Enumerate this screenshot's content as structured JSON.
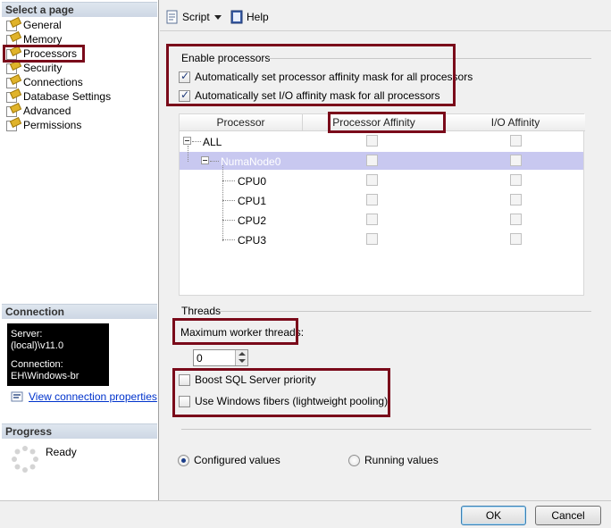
{
  "left_pane": {
    "select_page_header": "Select a page",
    "pages": [
      {
        "label": "General"
      },
      {
        "label": "Memory"
      },
      {
        "label": "Processors"
      },
      {
        "label": "Security"
      },
      {
        "label": "Connections"
      },
      {
        "label": "Database Settings"
      },
      {
        "label": "Advanced"
      },
      {
        "label": "Permissions"
      }
    ],
    "connection_header": "Connection",
    "connection": {
      "server_label": "Server:",
      "server_value": "(local)\\v11.0",
      "connection_label": "Connection:",
      "connection_value": "EH\\Windows-br"
    },
    "view_connection_properties": "View connection properties",
    "progress_header": "Progress",
    "progress_status": "Ready"
  },
  "toolbar": {
    "script_label": "Script",
    "help_label": "Help"
  },
  "enable_processors": {
    "group_label": "Enable processors",
    "auto_processor_affinity": {
      "label": "Automatically set processor affinity mask for all processors",
      "checked": true
    },
    "auto_io_affinity": {
      "label": "Automatically set I/O affinity mask for all processors",
      "checked": true
    }
  },
  "grid": {
    "columns": [
      "Processor",
      "Processor Affinity",
      "I/O Affinity"
    ],
    "rows": [
      {
        "name": "ALL",
        "level": 0
      },
      {
        "name": "NumaNode0",
        "level": 1,
        "selected": true
      },
      {
        "name": "CPU0",
        "level": 2
      },
      {
        "name": "CPU1",
        "level": 2
      },
      {
        "name": "CPU2",
        "level": 2
      },
      {
        "name": "CPU3",
        "level": 2
      }
    ],
    "selection_color": "#c8c8f0"
  },
  "threads": {
    "group_label": "Threads",
    "max_worker_threads_label": "Maximum worker threads:",
    "max_worker_threads_value": "0",
    "boost_priority": {
      "label": "Boost SQL Server priority",
      "checked": false
    },
    "windows_fibers": {
      "label": "Use Windows fibers (lightweight pooling)",
      "checked": false
    }
  },
  "values_mode": {
    "configured_label": "Configured  values",
    "running_label": "Running values",
    "selected": "configured"
  },
  "buttons": {
    "ok": "OK",
    "cancel": "Cancel"
  },
  "colors": {
    "highlight_border": "#7a0a1a",
    "link": "#0033cc"
  }
}
